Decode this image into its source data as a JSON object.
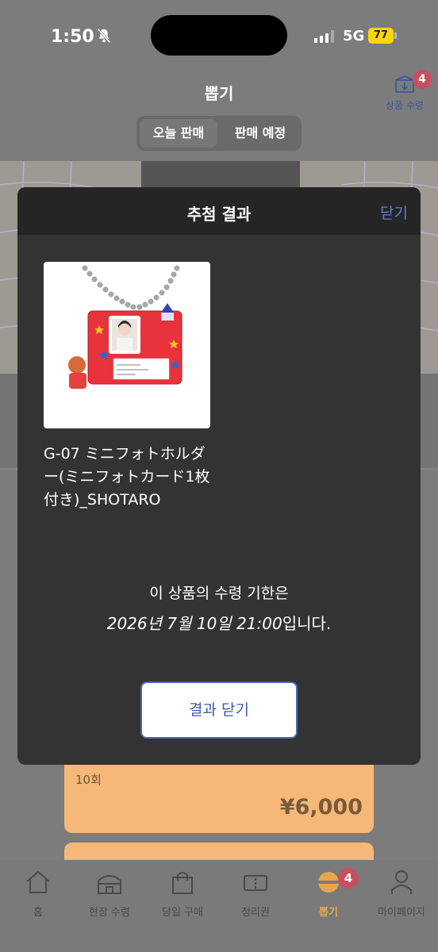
{
  "status_bar": {
    "time": "1:50",
    "network": "5G",
    "battery": "77"
  },
  "header": {
    "title": "뽑기",
    "receive_label": "상품 수령",
    "receive_badge": "4"
  },
  "tabs": [
    {
      "label": "오늘 판매",
      "active": true
    },
    {
      "label": "판매 예정",
      "active": false
    }
  ],
  "background_card": {
    "count": "10회",
    "price": "¥6,000"
  },
  "modal": {
    "title": "추첨 결과",
    "close_link": "닫기",
    "product_name": "G-07 ミニフォトホルダー(ミニフォトカード1枚付き)_SHOTARO",
    "deadline_prefix": "이 상품의 수령 기한은",
    "deadline_date": "2026년 7월 10일 21:00",
    "deadline_suffix": "입니다.",
    "close_button": "결과 닫기"
  },
  "bottom_nav": [
    {
      "label": "홈",
      "icon": "home-icon"
    },
    {
      "label": "현장 수령",
      "icon": "store-icon"
    },
    {
      "label": "당일 구매",
      "icon": "shopping-bag-icon"
    },
    {
      "label": "정리권",
      "icon": "ticket-icon"
    },
    {
      "label": "뽑기",
      "icon": "capsule-icon",
      "active": true,
      "badge": "4"
    },
    {
      "label": "마이페이지",
      "icon": "person-icon"
    }
  ],
  "colors": {
    "accent_blue": "#3e5aa6",
    "badge_red": "#c84f60",
    "active_orange": "#e8a64a",
    "price_card": "#f5b878"
  }
}
